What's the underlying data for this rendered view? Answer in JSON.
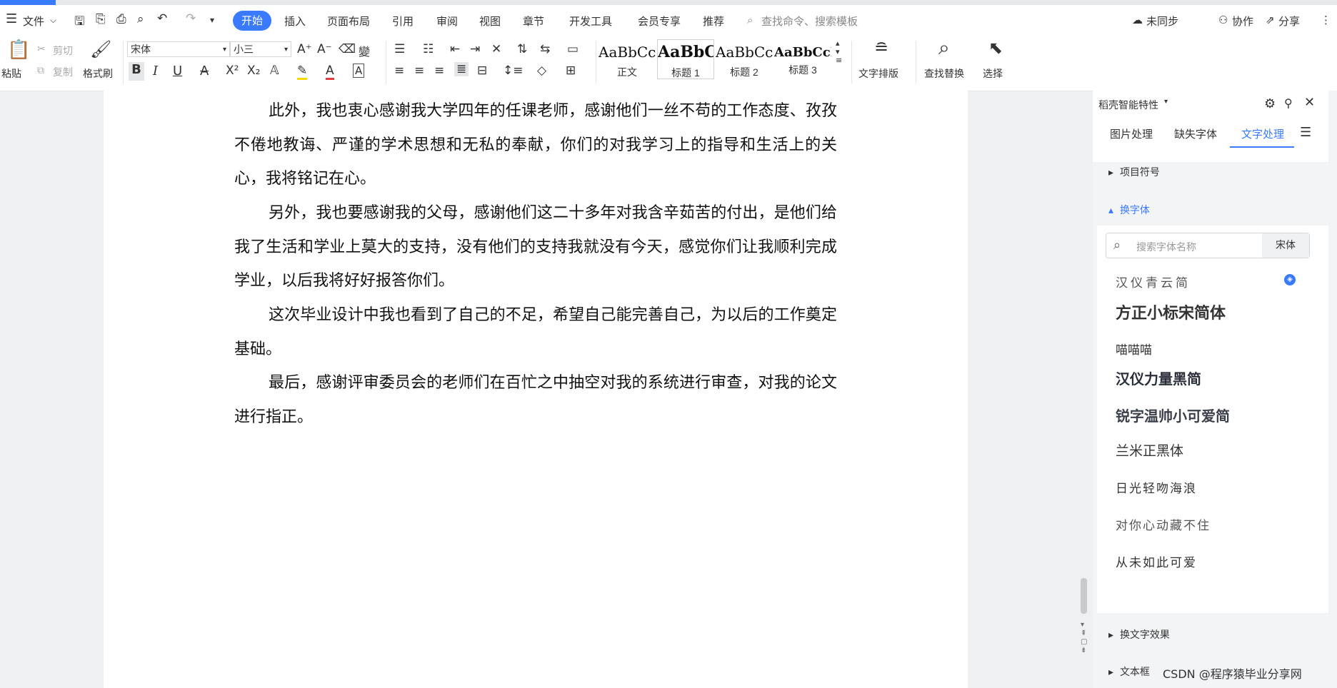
{
  "menu": {
    "file_label": "文件",
    "tabs": [
      "开始",
      "插入",
      "页面布局",
      "引用",
      "审阅",
      "视图",
      "章节",
      "开发工具",
      "会员专享",
      "推荐"
    ],
    "search_placeholder": "查找命令、搜索模板",
    "sync_label": "未同步",
    "collab_label": "协作",
    "share_label": "分享"
  },
  "toolbar": {
    "paste_label": "粘贴",
    "cut_label": "剪切",
    "copy_label": "复制",
    "format_painter_label": "格式刷",
    "font_name": "宋体",
    "font_size": "小三",
    "styles": [
      {
        "sample": "AaBbCcI",
        "label": "正文"
      },
      {
        "sample": "AaBbC",
        "label": "标题 1"
      },
      {
        "sample": "AaBbCc",
        "label": "标题 2"
      },
      {
        "sample": "AaBbCcI",
        "label": "标题 3"
      }
    ],
    "text_layout_label": "文字排版",
    "find_replace_label": "查找替换",
    "select_label": "选择"
  },
  "document": {
    "paragraphs": [
      "此外，我也衷心感谢我大学四年的任课老师，感谢他们一丝不苟的工作态度、孜孜不倦地教诲、严谨的学术思想和无私的奉献，你们的对我学习上的指导和生活上的关心，我将铭记在心。",
      "另外，我也要感谢我的父母，感谢他们这二十多年对我含辛茹苦的付出，是他们给我了生活和学业上莫大的支持，没有他们的支持我就没有今天，感觉你们让我顺利完成学业，以后我将好好报答你们。",
      "这次毕业设计中我也看到了自己的不足，希望自己能完善自己，为以后的工作奠定基础。",
      "最后，感谢评审委员会的老师们在百忙之中抽空对我的系统进行审查，对我的论文进行指正。"
    ]
  },
  "panel": {
    "title": "稻壳智能特性",
    "tabs": [
      "图片处理",
      "缺失字体",
      "文字处理"
    ],
    "active_tab": "文字处理",
    "bullet_section": "项目符号",
    "font_section": "换字体",
    "search_placeholder": "搜索字体名称",
    "current_font": "宋体",
    "fonts": [
      "汉仪青云简",
      "方正小标宋简体",
      "喵喵喵",
      "汉仪力量黑简",
      "锐字温帅小可爱简",
      "兰米正黑体",
      "日光轻吻海浪",
      "对你心动藏不住",
      "从未如此可爱"
    ],
    "effects_section": "换文字效果",
    "textbox_section": "文本框"
  },
  "watermark": "CSDN @程序猿毕业分享网",
  "colors": {
    "accent": "#3a7afe"
  }
}
